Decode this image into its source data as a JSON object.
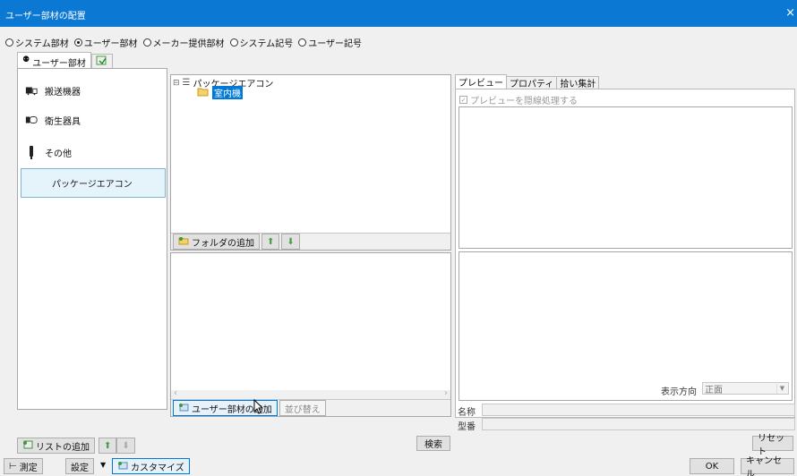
{
  "window": {
    "title": "ユーザー部材の配置",
    "close": "×"
  },
  "radio_options": [
    {
      "label": "システム部材",
      "selected": false
    },
    {
      "label": "ユーザー部材",
      "selected": true
    },
    {
      "label": "メーカー提供部材",
      "selected": false
    },
    {
      "label": "システム記号",
      "selected": false
    },
    {
      "label": "ユーザー記号",
      "selected": false
    }
  ],
  "top_tabs": {
    "active_label": "ユーザー部材"
  },
  "categories": [
    {
      "label": "搬送機器",
      "icon": "conveyor-icon"
    },
    {
      "label": "衛生器具",
      "icon": "sanitary-icon"
    },
    {
      "label": "その他",
      "icon": "other-icon"
    },
    {
      "label": "パッケージエアコン",
      "icon": "",
      "selected": true
    }
  ],
  "tree": {
    "root": "パッケージエアコン",
    "child": "室内機"
  },
  "tree_toolbar": {
    "add_folder": "フォルダの追加"
  },
  "parts_toolbar": {
    "add_user_part": "ユーザー部材の追加",
    "sort": "並び替え"
  },
  "right_tabs": [
    "プレビュー",
    "プロパティ",
    "拾い集計"
  ],
  "preview": {
    "hidden_line_label": "プレビューを隠線処理する",
    "direction_label": "表示方向",
    "direction_value": "正面"
  },
  "fields": {
    "name_label": "名称",
    "model_label": "型番"
  },
  "bottom": {
    "add_list": "リストの追加",
    "search": "検索",
    "reset": "リセット"
  },
  "status": {
    "measure": "測定",
    "settings": "設定",
    "customize": "カスタマイズ",
    "ok": "OK",
    "cancel": "キャンセル"
  },
  "colors": {
    "titlebar": "#0b78d4",
    "selection": "#0078d7",
    "selected_item_bg": "#e5f3fb"
  }
}
